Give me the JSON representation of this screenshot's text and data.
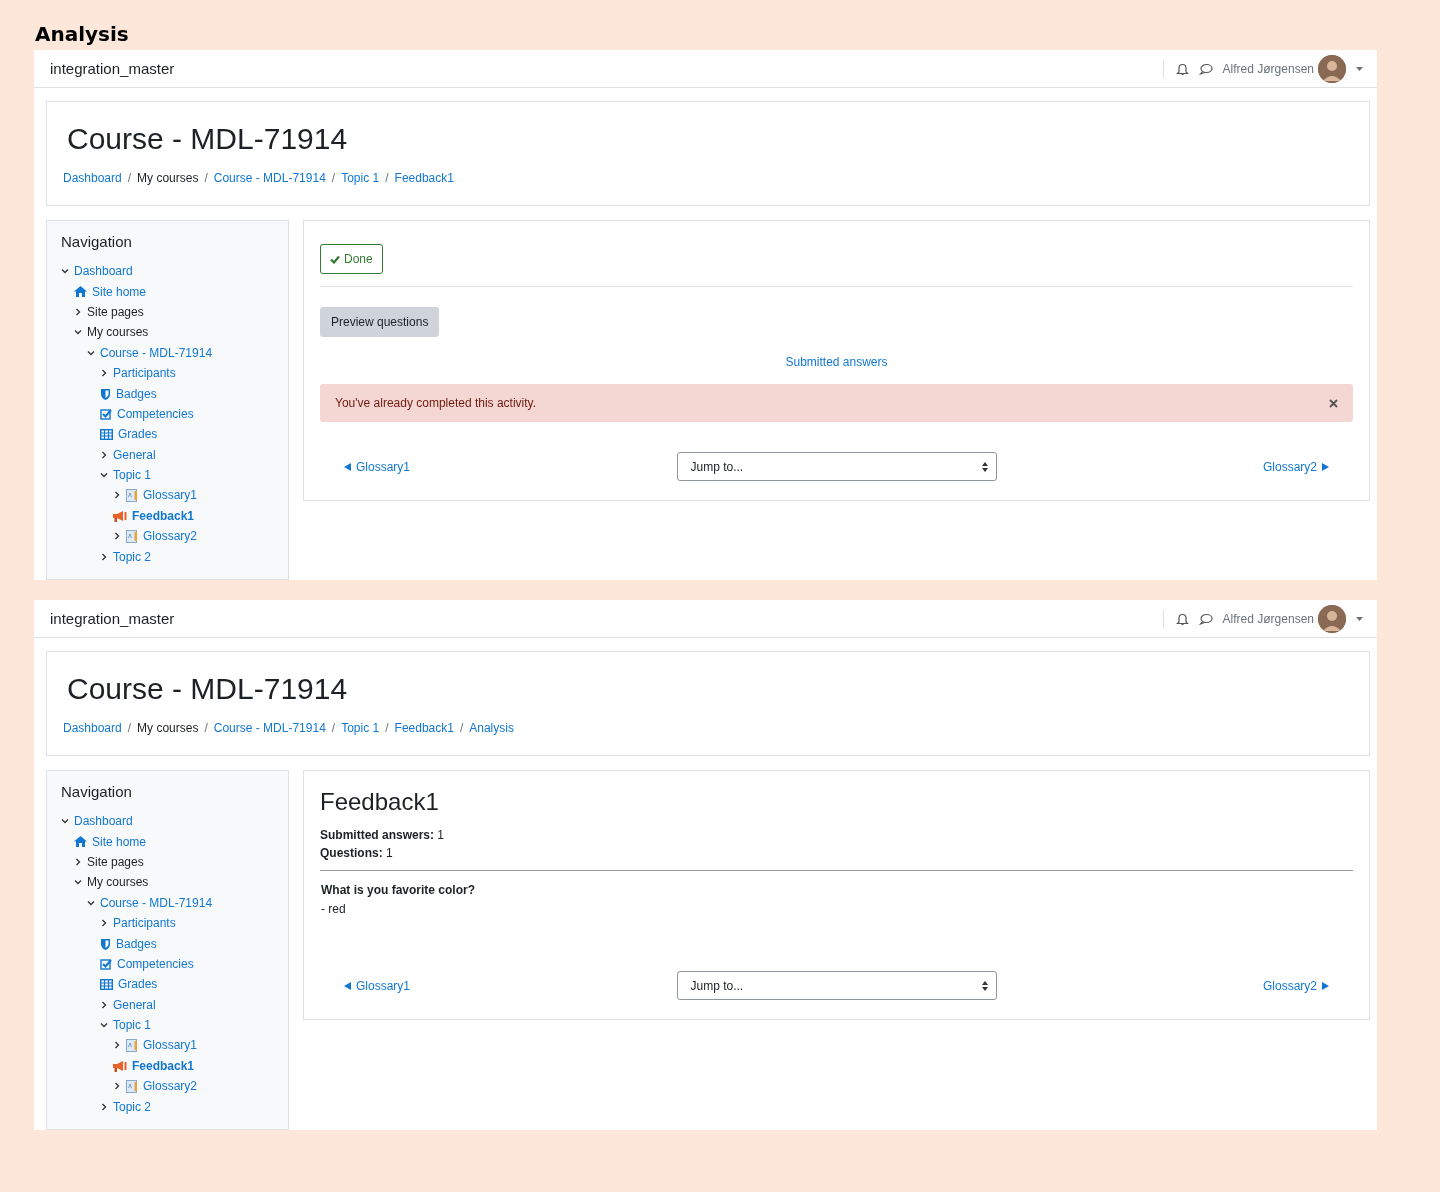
{
  "heading": "Analysis",
  "screens": [
    {
      "header": {
        "site_name": "integration_master",
        "user_name": "Alfred Jørgensen"
      },
      "course_title": "Course - MDL-71914",
      "breadcrumbs": [
        {
          "label": "Dashboard",
          "link": true
        },
        {
          "separator": "/",
          "label": "My courses",
          "link": false
        },
        {
          "separator": "/",
          "label": "Course - MDL-71914",
          "link": true
        },
        {
          "separator": "/",
          "label": "Topic 1",
          "link": true
        },
        {
          "separator": "/",
          "label": "Feedback1",
          "link": true
        }
      ],
      "navigation": {
        "title": "Navigation",
        "items": [
          {
            "label": "Dashboard",
            "kind": "branch",
            "expanded": true,
            "link": true,
            "selected": false,
            "children": [
              {
                "label": "Site home",
                "kind": "home",
                "link": true,
                "selected": false
              },
              {
                "label": "Site pages",
                "kind": "branch",
                "expanded": false,
                "link": false,
                "selected": false
              },
              {
                "label": "My courses",
                "kind": "branch",
                "expanded": true,
                "link": false,
                "selected": false,
                "children": [
                  {
                    "label": "Course - MDL-71914",
                    "kind": "branch",
                    "expanded": true,
                    "link": true,
                    "selected": false,
                    "children": [
                      {
                        "label": "Participants",
                        "kind": "branch",
                        "expanded": false,
                        "link": true,
                        "selected": false
                      },
                      {
                        "label": "Badges",
                        "kind": "badge",
                        "link": true,
                        "selected": false
                      },
                      {
                        "label": "Competencies",
                        "kind": "competency",
                        "link": true,
                        "selected": false
                      },
                      {
                        "label": "Grades",
                        "kind": "grades",
                        "link": true,
                        "selected": false
                      },
                      {
                        "label": "General",
                        "kind": "branch",
                        "expanded": false,
                        "link": true,
                        "selected": false
                      },
                      {
                        "label": "Topic 1",
                        "kind": "branch",
                        "expanded": true,
                        "link": true,
                        "selected": false,
                        "children": [
                          {
                            "label": "Glossary1",
                            "kind": "glossary",
                            "expanded": false,
                            "link": true,
                            "selected": false
                          },
                          {
                            "label": "Feedback1",
                            "kind": "feedback",
                            "link": true,
                            "selected": true
                          },
                          {
                            "label": "Glossary2",
                            "kind": "glossary",
                            "expanded": false,
                            "link": true,
                            "selected": false
                          }
                        ]
                      },
                      {
                        "label": "Topic 2",
                        "kind": "branch",
                        "expanded": false,
                        "link": true,
                        "selected": false
                      }
                    ]
                  }
                ]
              }
            ]
          }
        ]
      },
      "blocks": [
        {
          "kind": "completion",
          "label": "Done",
          "done": true
        },
        {
          "kind": "button",
          "label": "Preview questions"
        },
        {
          "kind": "link",
          "label": "Submitted answers"
        },
        {
          "kind": "alert",
          "text": "You've already completed this activity."
        }
      ],
      "activity_nav": {
        "prev": "Glossary1",
        "jump": "Jump to...",
        "next": "Glossary2"
      }
    },
    {
      "header": {
        "site_name": "integration_master",
        "user_name": "Alfred Jørgensen"
      },
      "course_title": "Course - MDL-71914",
      "breadcrumbs": [
        {
          "label": "Dashboard",
          "link": true
        },
        {
          "separator": "/",
          "label": "My courses",
          "link": false
        },
        {
          "separator": "/",
          "label": "Course - MDL-71914",
          "link": true
        },
        {
          "separator": "/",
          "label": "Topic 1",
          "link": true
        },
        {
          "separator": "/",
          "label": "Feedback1",
          "link": true
        },
        {
          "separator": "/",
          "label": "Analysis",
          "link": true
        }
      ],
      "navigation": {
        "title": "Navigation",
        "items": [
          {
            "label": "Dashboard",
            "kind": "branch",
            "expanded": true,
            "link": true,
            "selected": false,
            "children": [
              {
                "label": "Site home",
                "kind": "home",
                "link": true,
                "selected": false
              },
              {
                "label": "Site pages",
                "kind": "branch",
                "expanded": false,
                "link": false,
                "selected": false
              },
              {
                "label": "My courses",
                "kind": "branch",
                "expanded": true,
                "link": false,
                "selected": false,
                "children": [
                  {
                    "label": "Course - MDL-71914",
                    "kind": "branch",
                    "expanded": true,
                    "link": true,
                    "selected": false,
                    "children": [
                      {
                        "label": "Participants",
                        "kind": "branch",
                        "expanded": false,
                        "link": true,
                        "selected": false
                      },
                      {
                        "label": "Badges",
                        "kind": "badge",
                        "link": true,
                        "selected": false
                      },
                      {
                        "label": "Competencies",
                        "kind": "competency",
                        "link": true,
                        "selected": false
                      },
                      {
                        "label": "Grades",
                        "kind": "grades",
                        "link": true,
                        "selected": false
                      },
                      {
                        "label": "General",
                        "kind": "branch",
                        "expanded": false,
                        "link": true,
                        "selected": false
                      },
                      {
                        "label": "Topic 1",
                        "kind": "branch",
                        "expanded": true,
                        "link": true,
                        "selected": false,
                        "children": [
                          {
                            "label": "Glossary1",
                            "kind": "glossary",
                            "expanded": false,
                            "link": true,
                            "selected": false
                          },
                          {
                            "label": "Feedback1",
                            "kind": "feedback",
                            "link": true,
                            "selected": true
                          },
                          {
                            "label": "Glossary2",
                            "kind": "glossary",
                            "expanded": false,
                            "link": true,
                            "selected": false
                          }
                        ]
                      },
                      {
                        "label": "Topic 2",
                        "kind": "branch",
                        "expanded": false,
                        "link": true,
                        "selected": false
                      }
                    ]
                  }
                ]
              }
            ]
          }
        ]
      },
      "blocks": [
        {
          "kind": "heading",
          "text": "Feedback1"
        },
        {
          "kind": "stats",
          "lines": [
            "**Submitted answers:** 1",
            "**Questions:** 1"
          ]
        },
        {
          "kind": "question",
          "text": "What is you favorite color?",
          "answer": "- red"
        }
      ],
      "activity_nav": {
        "prev": "Glossary1",
        "jump": "Jump to...",
        "next": "Glossary2"
      }
    }
  ]
}
